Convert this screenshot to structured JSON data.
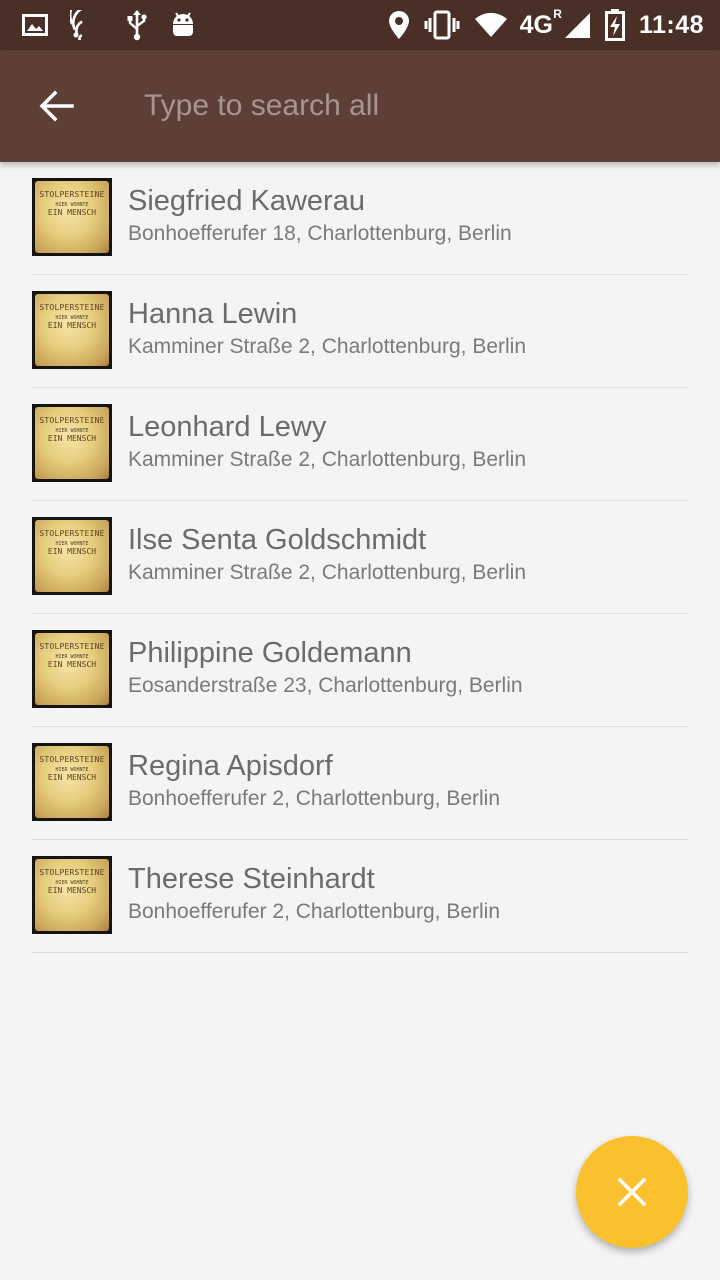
{
  "status_bar": {
    "time": "11:48",
    "network": "4G",
    "network_sup": "R",
    "left_icons": [
      "image-icon",
      "cast-icon",
      "usb-icon",
      "android-icon"
    ],
    "right_icons": [
      "location-icon",
      "vibrate-icon",
      "wifi-icon",
      "signal-icon",
      "battery-charging-icon"
    ]
  },
  "toolbar": {
    "back_icon": "arrow-back-icon",
    "search_placeholder": "Type to search all",
    "search_value": ""
  },
  "thumbnail_text": {
    "line1": "STOLPERSTEINE",
    "line2": "HIER WOHNTE",
    "line3": "EIN MENSCH"
  },
  "results": [
    {
      "name": "Siegfried Kawerau",
      "address": "Bonhoefferufer 18, Charlottenburg, Berlin"
    },
    {
      "name": "Hanna Lewin",
      "address": "Kamminer Straße 2, Charlottenburg, Berlin"
    },
    {
      "name": "Leonhard Lewy",
      "address": "Kamminer Straße 2, Charlottenburg, Berlin"
    },
    {
      "name": "Ilse Senta Goldschmidt",
      "address": "Kamminer Straße 2, Charlottenburg, Berlin"
    },
    {
      "name": "Philippine Goldemann",
      "address": "Eosanderstraße 23, Charlottenburg, Berlin"
    },
    {
      "name": "Regina Apisdorf",
      "address": "Bonhoefferufer 2, Charlottenburg, Berlin"
    },
    {
      "name": "Therese Steinhardt",
      "address": "Bonhoefferufer 2, Charlottenburg, Berlin"
    }
  ],
  "fab": {
    "icon": "close-icon"
  },
  "colors": {
    "status_bar": "#4a2f26",
    "toolbar": "#5d3f36",
    "background": "#f4f4f4",
    "fab": "#fbc02d",
    "name_text": "#6b6b6b",
    "address_text": "#7a7a7a"
  }
}
